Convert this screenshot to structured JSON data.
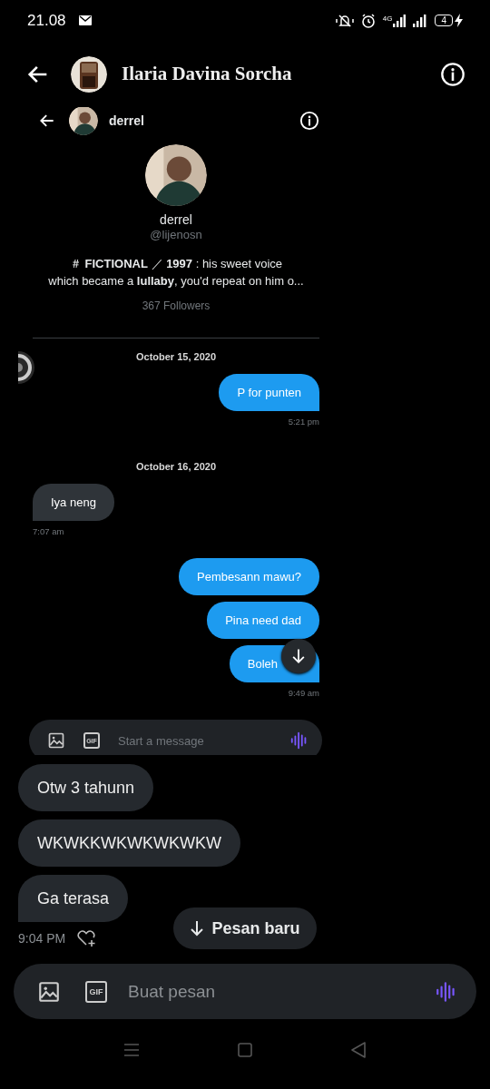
{
  "status_bar": {
    "time": "21.08",
    "network": "4G",
    "battery": "4"
  },
  "header": {
    "title": "Ilaria Davina Sorcha"
  },
  "shared_screenshot": {
    "header": {
      "name": "derrel"
    },
    "profile": {
      "name": "derrel",
      "handle": "@lijenosn",
      "bio": "＃ **FICTIONAL** ／ **1997** :  his sweet voice\nwhich became a **lullaby**, you'd repeat on him o...",
      "followers": "367 Followers"
    },
    "items": [
      {
        "kind": "date",
        "text": "October 15, 2020"
      },
      {
        "kind": "message",
        "text": "P for punten",
        "sent": true
      },
      {
        "kind": "time",
        "text": "5:21 pm",
        "sent": true
      },
      {
        "kind": "date",
        "text": "October 16, 2020"
      },
      {
        "kind": "message",
        "text": "Iya neng",
        "sent": false
      },
      {
        "kind": "time",
        "text": "7:07 am",
        "sent": false
      },
      {
        "kind": "message",
        "text": "Pembesann mawu?",
        "sent": true
      },
      {
        "kind": "message",
        "text": "Pina need dad",
        "sent": true
      },
      {
        "kind": "message",
        "text": "Boleh",
        "sent": true
      },
      {
        "kind": "time",
        "text": "9:49 am",
        "sent": true
      }
    ],
    "composer": {
      "placeholder": "Start a message",
      "gif_label": "GIF"
    }
  },
  "messages": [
    {
      "text": "Otw 3 tahunn"
    },
    {
      "text": "WKWKKWKWKWKWKW"
    },
    {
      "text": "Ga terasa"
    }
  ],
  "last_time": "9:04 PM",
  "new_messages_button": {
    "label": "Pesan baru"
  },
  "composer": {
    "placeholder": "Buat pesan",
    "gif_label": "GIF"
  }
}
